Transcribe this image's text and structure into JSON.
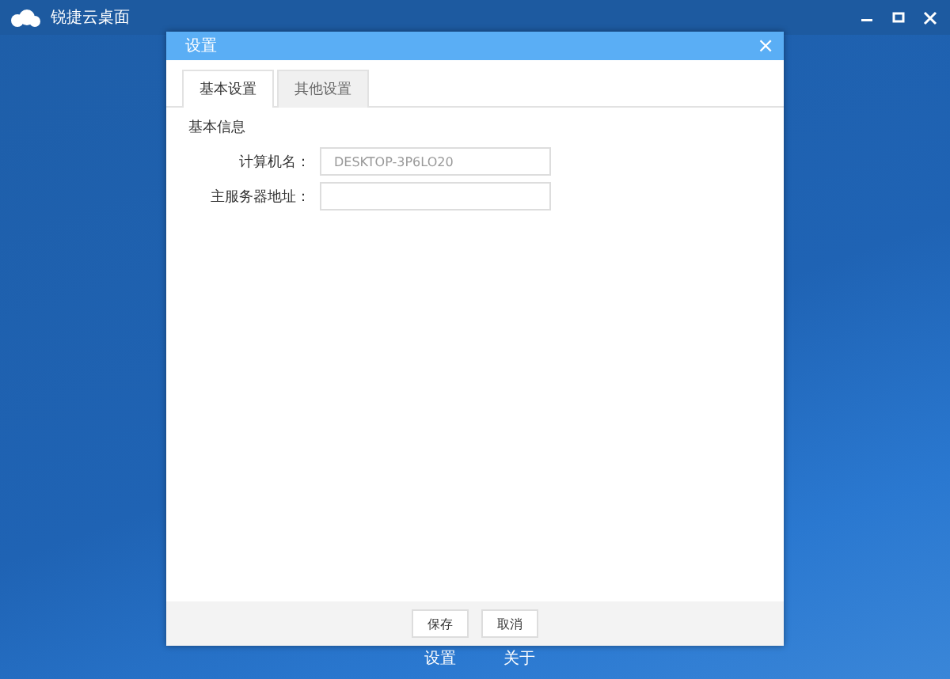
{
  "app": {
    "title": "锐捷云桌面"
  },
  "bottom_nav": [
    {
      "label": "设置"
    },
    {
      "label": "关于"
    }
  ],
  "dialog": {
    "title": "设置",
    "close": "×",
    "tabs": [
      {
        "label": "基本设置",
        "selected": true
      },
      {
        "label": "其他设置",
        "selected": false
      }
    ],
    "section": "基本信息",
    "fields": [
      {
        "label": "计算机名：",
        "value": "DESKTOP-3P6LO20"
      },
      {
        "label": "主服务器地址："
      }
    ],
    "buttons": [
      "保存",
      "取消"
    ]
  }
}
